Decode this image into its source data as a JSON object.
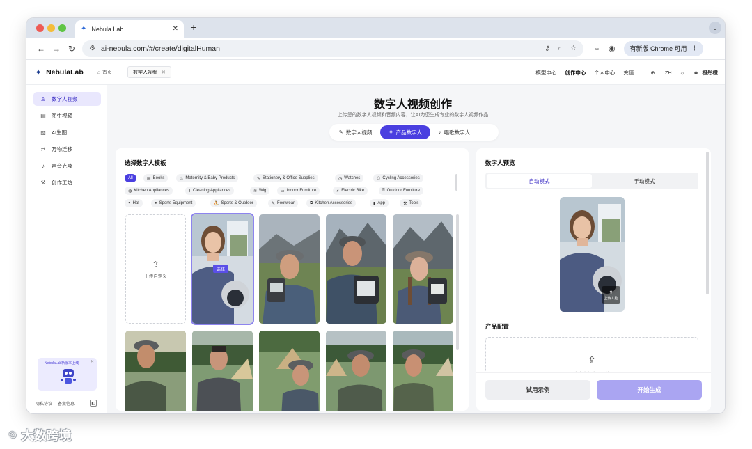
{
  "browser": {
    "tab_title": "Nebula Lab",
    "url": "ai-nebula.com/#/create/digitalHuman",
    "update_label": "有新版 Chrome 可用"
  },
  "app": {
    "brand": "NebulaLab",
    "home_label": "首页",
    "open_tab": "数字人视频",
    "nav": {
      "model_center": "模型中心",
      "create_center": "创作中心",
      "personal_center": "个人中心",
      "recharge": "充值",
      "lang": "ZH",
      "user": "橙彤橙"
    }
  },
  "sidebar": {
    "items": [
      {
        "label": "数字人视频",
        "icon": "person-icon"
      },
      {
        "label": "图生视频",
        "icon": "film-icon"
      },
      {
        "label": "AI生图",
        "icon": "image-icon"
      },
      {
        "label": "万物迁移",
        "icon": "swap-icon"
      },
      {
        "label": "声音克隆",
        "icon": "mic-icon"
      },
      {
        "label": "创作工坊",
        "icon": "tool-icon"
      }
    ],
    "promo_text": "NebulaLab新版本上线",
    "footer": {
      "privacy": "隐私协议",
      "record": "备案信息"
    }
  },
  "main": {
    "title": "数字人视频创作",
    "subtitle": "上传您的数字人视频和音频内容，让AI为您生成专业的数字人视频作品",
    "mode_tabs": [
      "数字人视频",
      "产品数字人",
      "唱歌数字人"
    ]
  },
  "template_panel": {
    "title": "选择数字人模板",
    "categories": [
      "All",
      "Books",
      "Maternity & Baby Products",
      "Stationery & Office Supplies",
      "Watches",
      "Cycling Accessories",
      "Kitchen Appliances",
      "Cleaning Appliances",
      "Wig",
      "Indoor Furniture",
      "Electric Bike",
      "Outdoor Furniture",
      "Hat",
      "Sports Equipment",
      "Sports & Outdoor",
      "Footwear",
      "Kitchen Accessories",
      "App",
      "Tools"
    ],
    "upload_custom": "上传自定义",
    "select_badge": "选择"
  },
  "preview_panel": {
    "title": "数字人预览",
    "modes": [
      "自动模式",
      "手动模式"
    ],
    "upload_face": "上传人脸",
    "product_config": "产品配置",
    "product_upload_hint": "点击上传产品图片",
    "demo_button": "试用示例",
    "start_button": "开始生成"
  },
  "watermark": "大数跨境"
}
